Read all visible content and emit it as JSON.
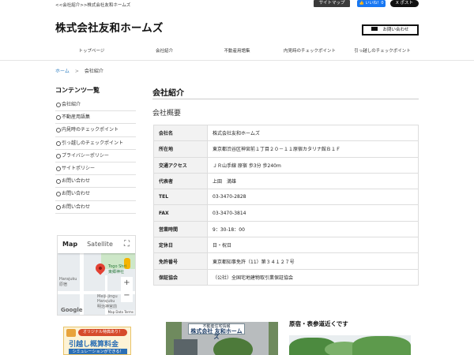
{
  "header": {
    "tagline": "<<会社紹介>>株式会社友和ホームズ",
    "sitemap_label": "サイトマップ",
    "like_label": "👍 いいね！0",
    "post_label": "X ポスト",
    "site_title": "株式会社友和ホームズ",
    "contact_label": "お問い合わせ"
  },
  "gnav": {
    "items": [
      {
        "label": "トップページ"
      },
      {
        "label": "会社紹介"
      },
      {
        "label": "不動産用語集"
      },
      {
        "label": "内見時のチェックポイント"
      },
      {
        "label": "引っ越しのチェックポイント"
      }
    ]
  },
  "breadcrumb": {
    "home": "ホーム",
    "sep": ">",
    "current": "会社紹介"
  },
  "sidebar": {
    "heading": "コンテンツ一覧",
    "items": [
      {
        "label": "会社紹介"
      },
      {
        "label": "不動産用語集"
      },
      {
        "label": "内見時のチェックポイント"
      },
      {
        "label": "引っ越しのチェックポイント"
      },
      {
        "label": "プライバシーポリシー"
      },
      {
        "label": "サイトポリシー"
      },
      {
        "label": "お問い合わせ"
      },
      {
        "label": "お問い合わせ"
      },
      {
        "label": "お問い合わせ"
      }
    ],
    "map": {
      "tab_map": "Map",
      "tab_satellite": "Satellite",
      "place_label": "Togo Shri",
      "place_label2": "東郷神社",
      "harajuku": "Harajuku",
      "harajuku_ja": "原宿",
      "meiji": "Meiji-jingu",
      "meiji2": "Harajuku",
      "meiji_ja": "明治神宮前",
      "google": "Google",
      "footer": "Map Data  Terms"
    },
    "banner": {
      "line1": "オリジナル特典あり！",
      "line2": "引越し概算料金",
      "line3": "シミュレーションができる！"
    }
  },
  "main": {
    "title": "会社紹介",
    "subtitle": "会社概要",
    "rows": [
      {
        "k": "会社名",
        "v": "株式会社友和ホームズ"
      },
      {
        "k": "所在地",
        "v": "東京都渋谷区神宮前１丁目２０－１１原宿カタリナ館Ｂ１Ｆ"
      },
      {
        "k": "交通アクセス",
        "v": "ＪＲ山手線 原宿 歩3分 歩240m"
      },
      {
        "k": "代表者",
        "v": "上田　満雄"
      },
      {
        "k": "TEL",
        "v": "03-3470-2828"
      },
      {
        "k": "FAX",
        "v": "03-3470-3814"
      },
      {
        "k": "営業時間",
        "v": "9：30-18：00"
      },
      {
        "k": "定休日",
        "v": "日・祝日"
      },
      {
        "k": "免許番号",
        "v": "東京都知事免許（11）第３４１２７号"
      },
      {
        "k": "保証協会",
        "v": "（公社）全国宅地建物取引業保証協会"
      }
    ],
    "photo1": {
      "sign_small": "不動産住宅情報",
      "sign_name": "株式会社 友和ホームズ"
    },
    "photo2_heading": "原宿・表参道近くです"
  }
}
